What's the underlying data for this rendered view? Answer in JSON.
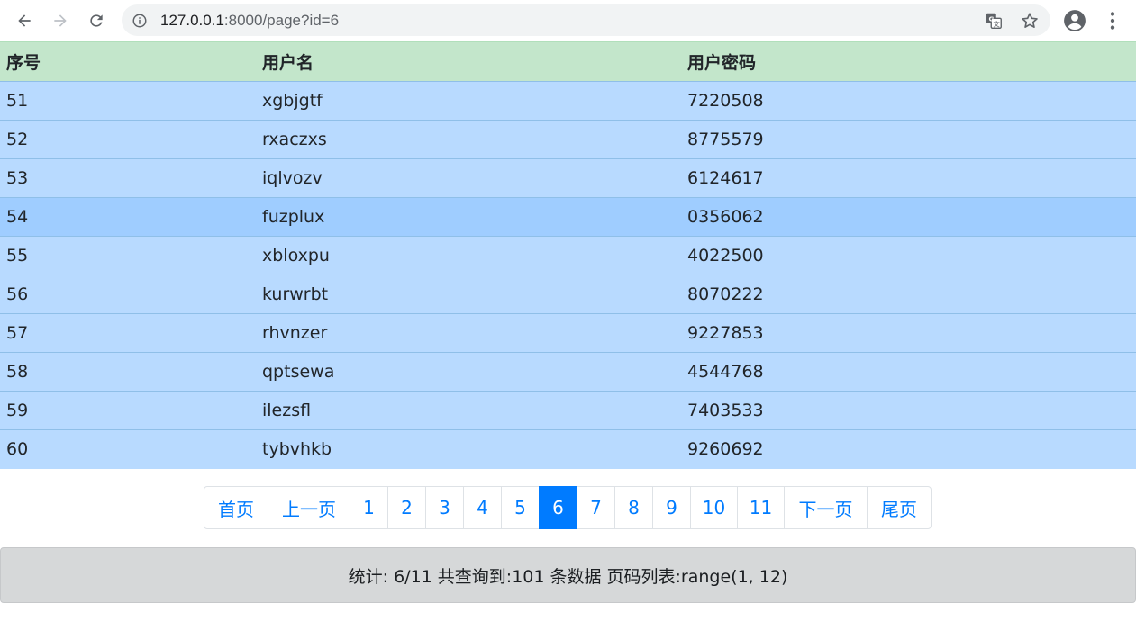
{
  "browser": {
    "url_host": "127.0.0.1",
    "url_rest": ":8000/page?id=6",
    "icons": {
      "back": "arrow-left-icon",
      "forward": "arrow-right-icon",
      "reload": "reload-icon",
      "info": "info-icon",
      "translate": "translate-icon",
      "bookmark": "star-icon",
      "profile": "account-circle-icon",
      "menu": "more-vert-icon"
    }
  },
  "table": {
    "headers": [
      "序号",
      "用户名",
      "用户密码"
    ],
    "rows": [
      [
        "51",
        "xgbjgtf",
        "7220508"
      ],
      [
        "52",
        "rxaczxs",
        "8775579"
      ],
      [
        "53",
        "iqlvozv",
        "6124617"
      ],
      [
        "54",
        "fuzplux",
        "0356062"
      ],
      [
        "55",
        "xbloxpu",
        "4022500"
      ],
      [
        "56",
        "kurwrbt",
        "8070222"
      ],
      [
        "57",
        "rhvnzer",
        "9227853"
      ],
      [
        "58",
        "qptsewa",
        "4544768"
      ],
      [
        "59",
        "ilezsfl",
        "7403533"
      ],
      [
        "60",
        "tybvhkb",
        "9260692"
      ]
    ],
    "hovered_row": 3
  },
  "pagination": {
    "items": [
      "首页",
      "上一页",
      "1",
      "2",
      "3",
      "4",
      "5",
      "6",
      "7",
      "8",
      "9",
      "10",
      "11",
      "下一页",
      "尾页"
    ],
    "active_index": 7
  },
  "stats": {
    "text": "统计: 6/11 共查询到:101 条数据 页码列表:range(1, 12)"
  },
  "colors": {
    "header_bg": "#c3e6cb",
    "row_bg": "#b8daff",
    "row_hover_bg": "#9fcdff",
    "link": "#007bff",
    "stats_bg": "#d6d8d9"
  }
}
